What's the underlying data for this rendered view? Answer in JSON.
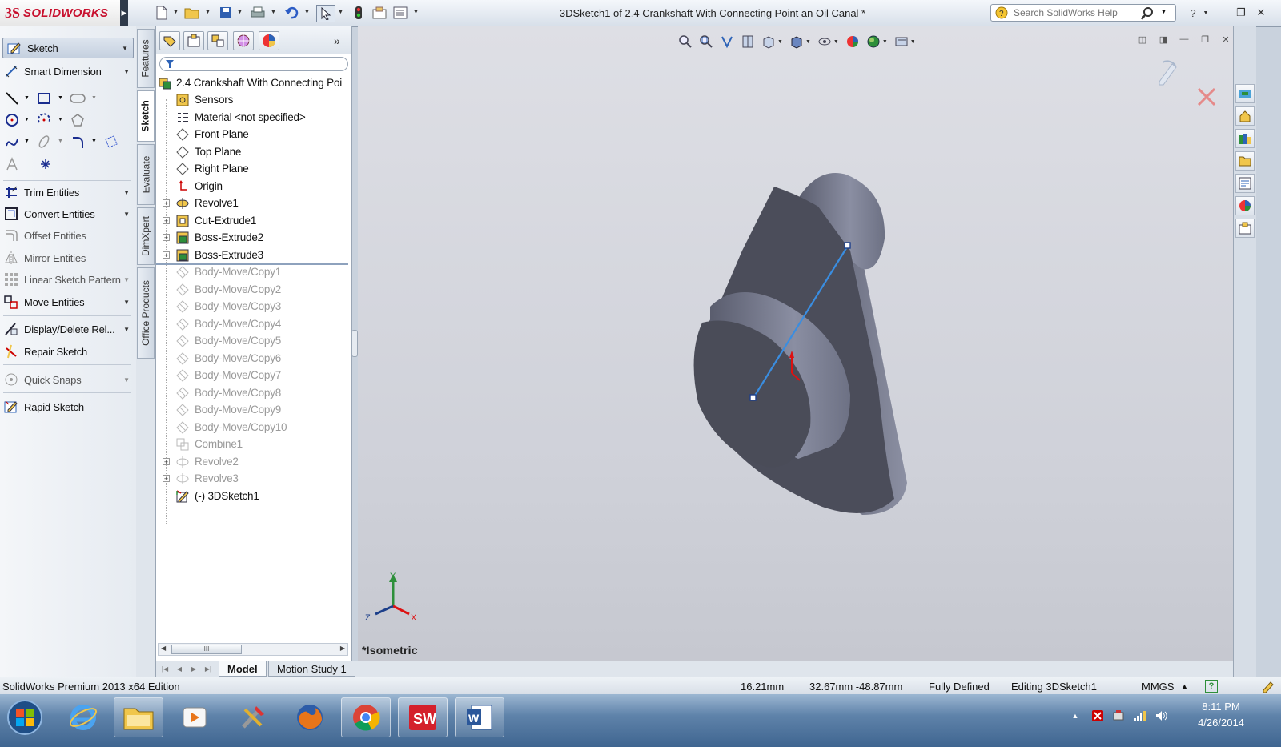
{
  "app": {
    "logo_symbol": "3S",
    "logo_text": "SOLIDWORKS",
    "document_title": "3DSketch1 of 2.4 Crankshaft With Connecting Point an Oil Canal *",
    "search_placeholder": "Search SolidWorks Help"
  },
  "command_manager": {
    "sketch_label": "Sketch",
    "smart_dimension_label": "Smart Dimension",
    "trim_entities_label": "Trim Entities",
    "convert_entities_label": "Convert Entities",
    "offset_entities_label": "Offset Entities",
    "mirror_entities_label": "Mirror Entities",
    "linear_pattern_label": "Linear Sketch Pattern",
    "move_entities_label": "Move Entities",
    "display_delete_label": "Display/Delete Rel...",
    "repair_sketch_label": "Repair Sketch",
    "quick_snaps_label": "Quick Snaps",
    "rapid_sketch_label": "Rapid Sketch"
  },
  "vertical_tabs": {
    "features": "Features",
    "sketch": "Sketch",
    "evaluate": "Evaluate",
    "dimxpert": "DimXpert",
    "office_products": "Office Products",
    "active": "sketch"
  },
  "feature_tree": {
    "root": "2.4 Crankshaft With Connecting Poi",
    "sensors": "Sensors",
    "material": "Material <not specified>",
    "front_plane": "Front Plane",
    "top_plane": "Top Plane",
    "right_plane": "Right Plane",
    "origin": "Origin",
    "revolve1": "Revolve1",
    "cut_extrude1": "Cut-Extrude1",
    "boss_extrude2": "Boss-Extrude2",
    "boss_extrude3": "Boss-Extrude3",
    "copy1": "Body-Move/Copy1",
    "copy2": "Body-Move/Copy2",
    "copy3": "Body-Move/Copy3",
    "copy4": "Body-Move/Copy4",
    "copy5": "Body-Move/Copy5",
    "copy6": "Body-Move/Copy6",
    "copy7": "Body-Move/Copy7",
    "copy8": "Body-Move/Copy8",
    "copy9": "Body-Move/Copy9",
    "copy10": "Body-Move/Copy10",
    "combine1": "Combine1",
    "revolve2": "Revolve2",
    "revolve3": "Revolve3",
    "sketch3d": "(-) 3DSketch1",
    "scroll_thumb": "III"
  },
  "viewport": {
    "view_name": "*Isometric",
    "triad": {
      "x": "X",
      "y": "Y",
      "z": "Z"
    },
    "colors": {
      "part_face": "#4b4d5a",
      "part_side": "#7c7f92",
      "sketch_line": "#3a8de0"
    }
  },
  "bottom_tabs": {
    "model": "Model",
    "motion_study": "Motion Study 1",
    "active": "model"
  },
  "status_bar": {
    "edition": "SolidWorks Premium 2013 x64 Edition",
    "length": "16.21mm",
    "coords": "32.67mm -48.87mm",
    "state": "Fully Defined",
    "editing": "Editing 3DSketch1",
    "units": "MMGS",
    "units_arrow": "▲",
    "help": "?"
  },
  "taskbar": {
    "clock_time": "8:11 PM",
    "clock_date": "4/26/2014"
  }
}
